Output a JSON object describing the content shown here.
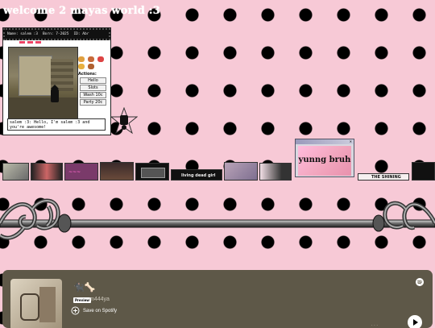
{
  "page": {
    "title": "welcome 2 mayas world :3"
  },
  "pet": {
    "name_label": "Name: salem :3",
    "born_label": "Born: 7-2025",
    "id_label": "ID: Abr",
    "speech": "salem :3: Hello, I'm salem :3 and you're awesome!",
    "actions_label": "Actions:",
    "actions": [
      "Hello",
      "Slots",
      "Wash 10c",
      "Party 20c"
    ]
  },
  "stamps": {
    "living_dead": "living dead girl",
    "yunng_bruh": "yunng bruh",
    "the_shining": "THE SHINING"
  },
  "spotify": {
    "track": "🐈‍⬛🦴",
    "preview_badge": "Preview",
    "artist": "m444ya",
    "save_label": "Save on Spotify"
  }
}
